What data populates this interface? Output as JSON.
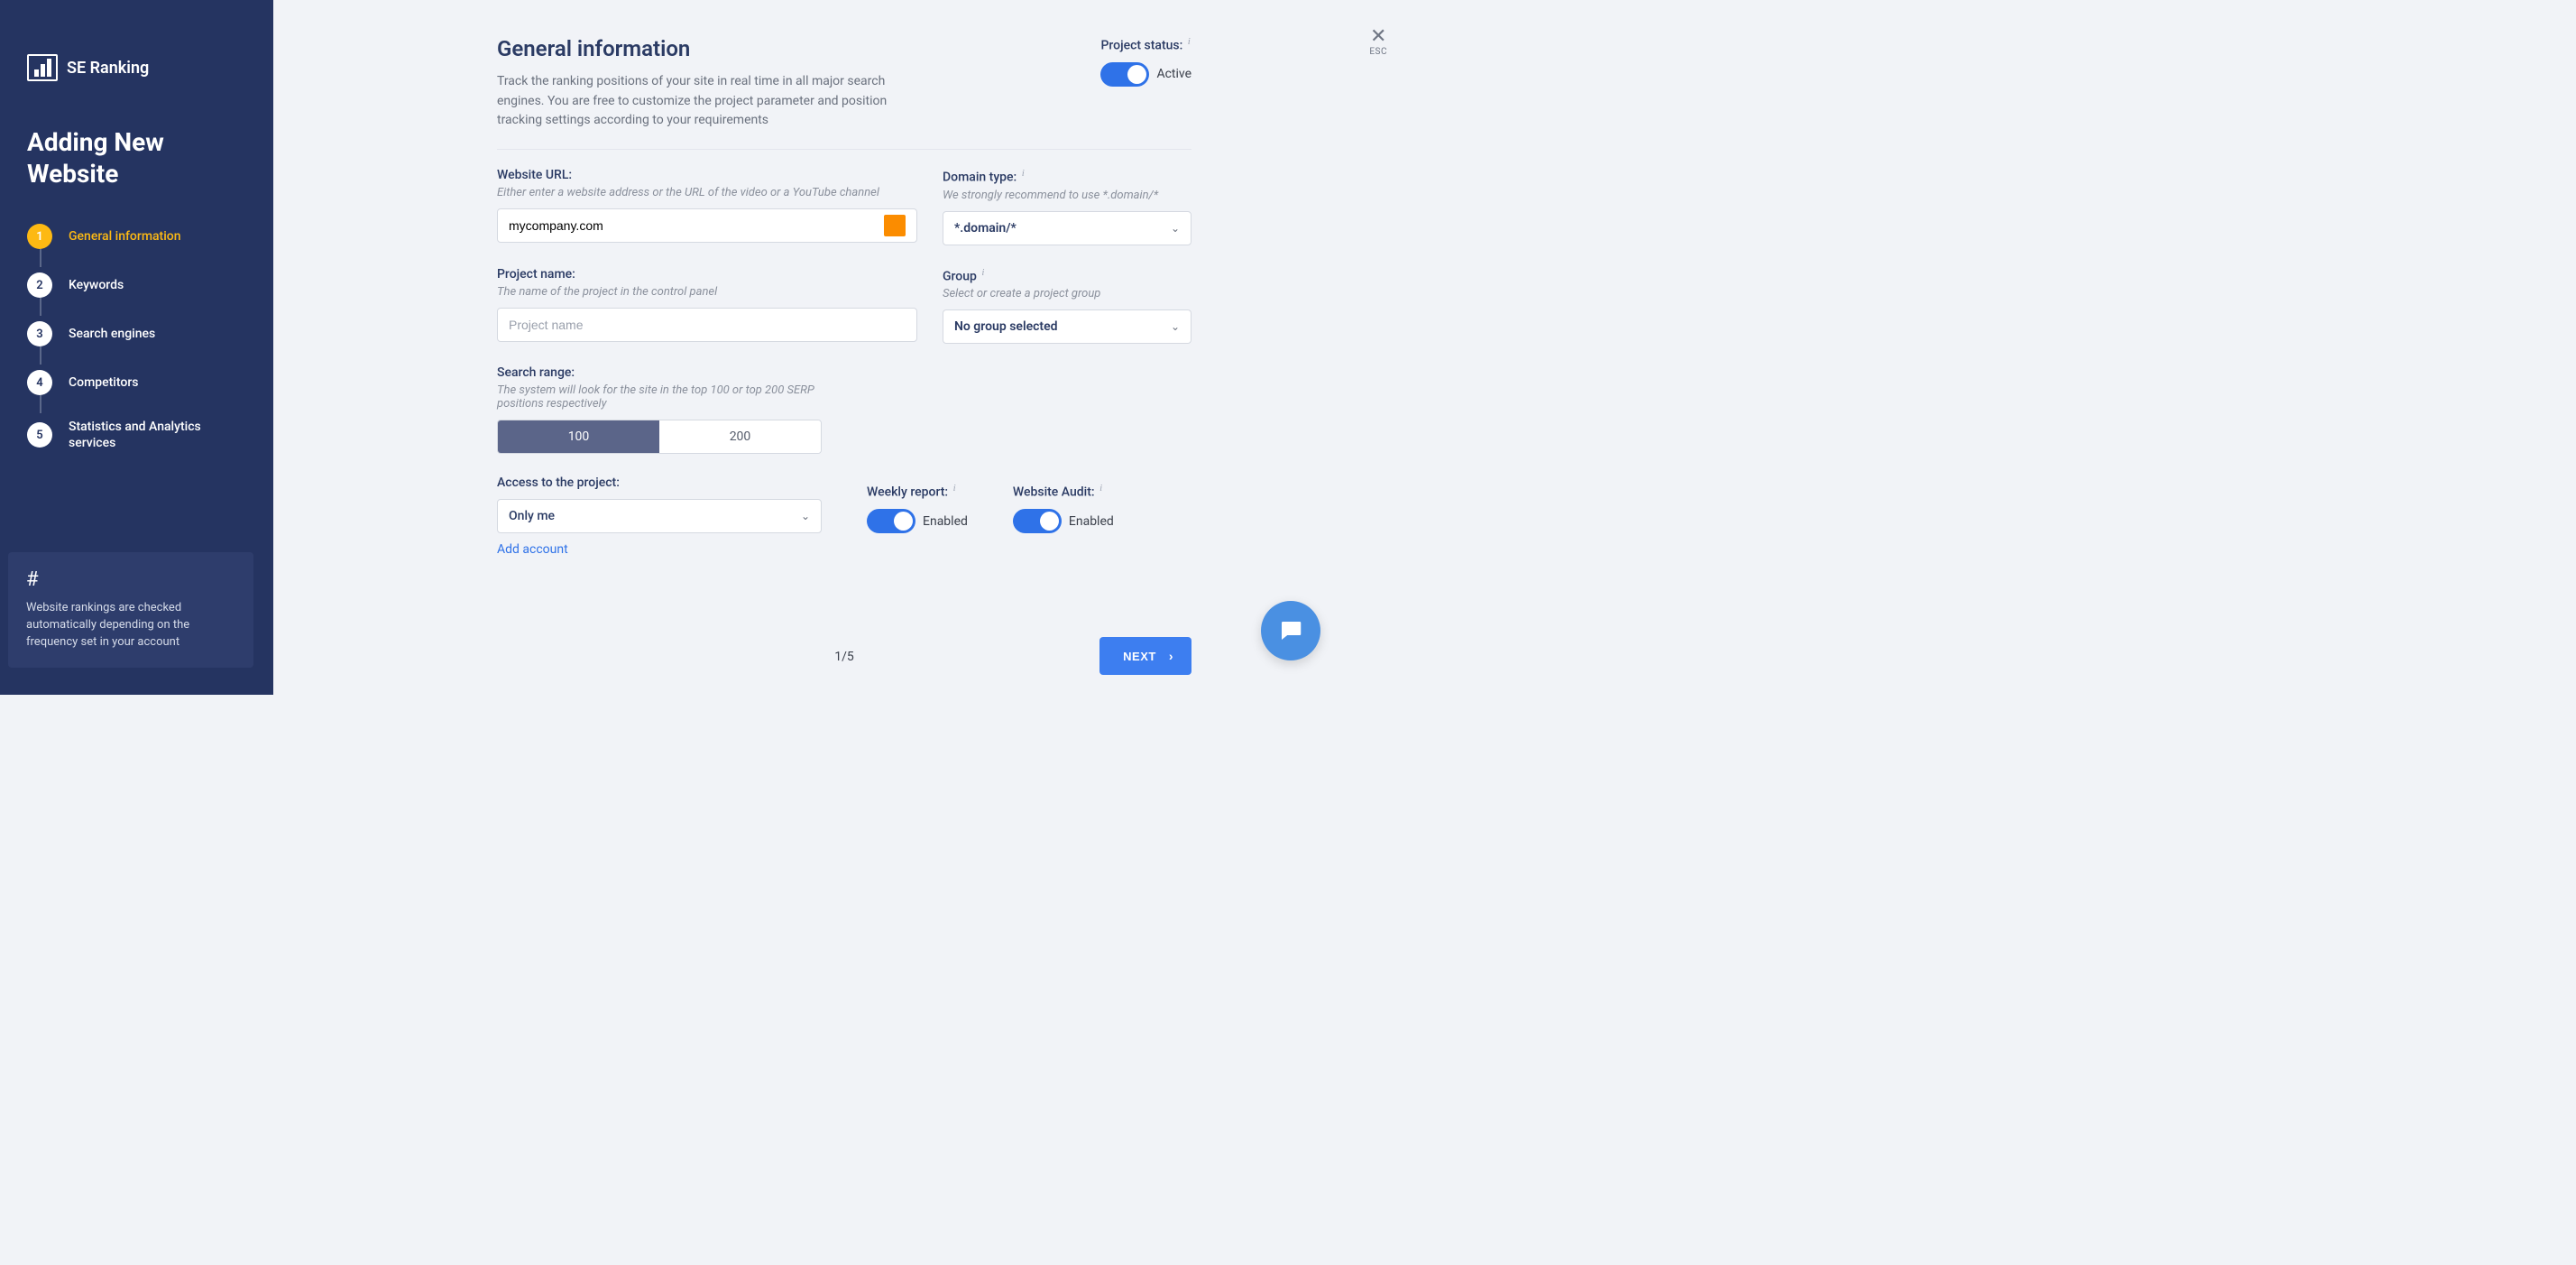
{
  "brand": {
    "name": "SE Ranking"
  },
  "sidebar": {
    "title": "Adding New Website",
    "steps": [
      {
        "num": "1",
        "label": "General information",
        "active": true
      },
      {
        "num": "2",
        "label": "Keywords"
      },
      {
        "num": "3",
        "label": "Search engines"
      },
      {
        "num": "4",
        "label": "Competitors"
      },
      {
        "num": "5",
        "label": "Statistics and Analytics services"
      }
    ],
    "tip": {
      "icon": "#",
      "text": "Website rankings are checked automatically depending on the frequency set in your account"
    }
  },
  "esc": {
    "label": "ESC"
  },
  "header": {
    "title": "General information",
    "desc": "Track the ranking positions of your site in real time in all major search engines. You are free to customize the project parameter and position tracking settings according to your requirements"
  },
  "status": {
    "label": "Project status:",
    "value": "Active",
    "on": true
  },
  "website_url": {
    "label": "Website URL:",
    "hint": "Either enter a website address or the URL of the video or a YouTube channel",
    "value": "mycompany.com"
  },
  "domain_type": {
    "label": "Domain type:",
    "hint": "We strongly recommend to use *.domain/*",
    "value": "*.domain/*"
  },
  "project_name": {
    "label": "Project name:",
    "hint": "The name of the project in the control panel",
    "placeholder": "Project name",
    "value": ""
  },
  "group": {
    "label": "Group",
    "hint": "Select or create a project group",
    "value": "No group selected"
  },
  "search_range": {
    "label": "Search range:",
    "hint": "The system will look for the site in the top 100 or top 200 SERP positions respectively",
    "options": [
      "100",
      "200"
    ],
    "selected": "100"
  },
  "access": {
    "label": "Access to the project:",
    "value": "Only me",
    "add_link": "Add account"
  },
  "weekly_report": {
    "label": "Weekly report:",
    "value": "Enabled",
    "on": true
  },
  "audit": {
    "label": "Website Audit:",
    "value": "Enabled",
    "on": true
  },
  "footer": {
    "pager": "1/5",
    "next": "NEXT"
  }
}
